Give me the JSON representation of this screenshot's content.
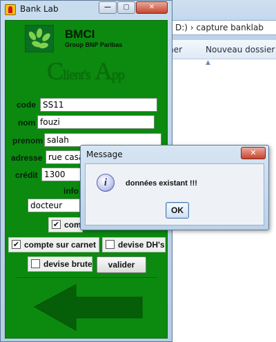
{
  "explorer": {
    "address_text": "D:) › capture banklab",
    "cmd_partial": "mer",
    "cmd_new_folder": "Nouveau dossier"
  },
  "bank_window": {
    "title": "Bank Lab",
    "min_label": "—",
    "max_label": "▢",
    "close_label": "✕",
    "brand": "BMCI",
    "brand_sub": "Group BNP Paribas",
    "app_title_c": "C",
    "app_title_lient": "lient's",
    "app_title_a": "A",
    "app_title_pp": "pp",
    "form": {
      "code_label": "code",
      "code_value": "SS11",
      "nom_label": "nom",
      "nom_value": "fouzi",
      "prenom_label": "prenom",
      "prenom_value": "salah",
      "adresse_label": "adresse",
      "adresse_value": "rue casa",
      "credit_label": "crédit",
      "credit_value": "1300",
      "info_label": "info",
      "profession_value": "docteur",
      "compte_partial_label": "com",
      "compte_partial_checked": true,
      "compte_carnet_label": "compte sur carnet",
      "compte_carnet_checked": true,
      "devise_dh_label": "devise DH's",
      "devise_dh_checked": false,
      "devise_brute_label": "devise brute",
      "devise_brute_checked": false,
      "valider_label": "valider"
    },
    "check_mark": "✔"
  },
  "dialog": {
    "title": "Message",
    "close_label": "✕",
    "info_glyph": "i",
    "message": "données existant !!!",
    "ok_label": "OK"
  },
  "colors": {
    "form_green": "#0b8a0f",
    "arrow_green": "#075e08"
  }
}
